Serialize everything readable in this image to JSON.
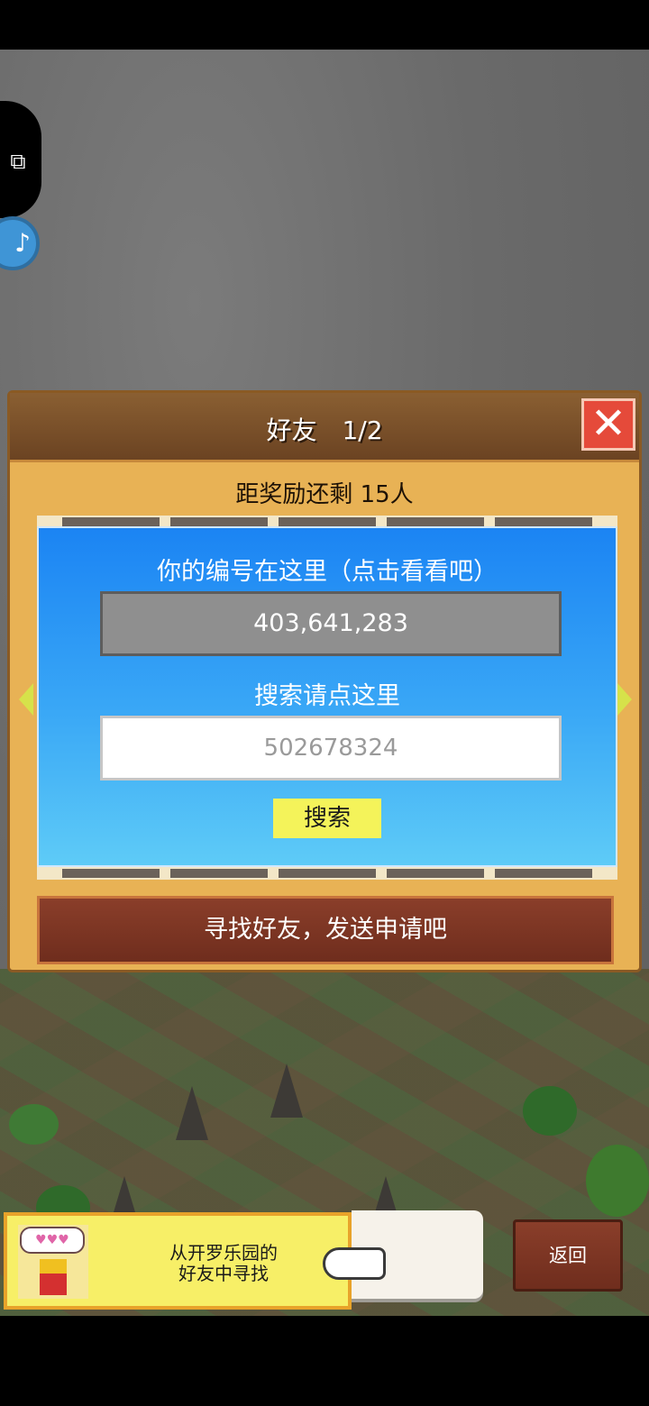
{
  "dialog": {
    "title": "好友　1/2",
    "close_label": "✕",
    "reward_text": "距奖励还剩 15人",
    "id_prompt": "你的编号在这里（点击看看吧）",
    "player_id": "403,641,283",
    "search_prompt": "搜索请点这里",
    "search_placeholder": "502678324",
    "search_button": "搜索",
    "find_button": "寻找好友，发送申请吧"
  },
  "banner": {
    "bubble": "♥♥♥",
    "line1": "从开罗乐园的",
    "line2": "好友中寻找"
  },
  "footer": {
    "back_label": "返回"
  },
  "icons": {
    "puzzle": "puzzle-icon",
    "music": "music-note-icon",
    "close": "close-icon",
    "left": "arrow-left-icon",
    "right": "arrow-right-icon",
    "pointer": "pointing-hand-icon"
  },
  "colors": {
    "dialog_bg": "#e8b255",
    "panel_blue": "#1b84f3",
    "close_red": "#e54a3a",
    "search_yellow": "#f4f35a"
  }
}
